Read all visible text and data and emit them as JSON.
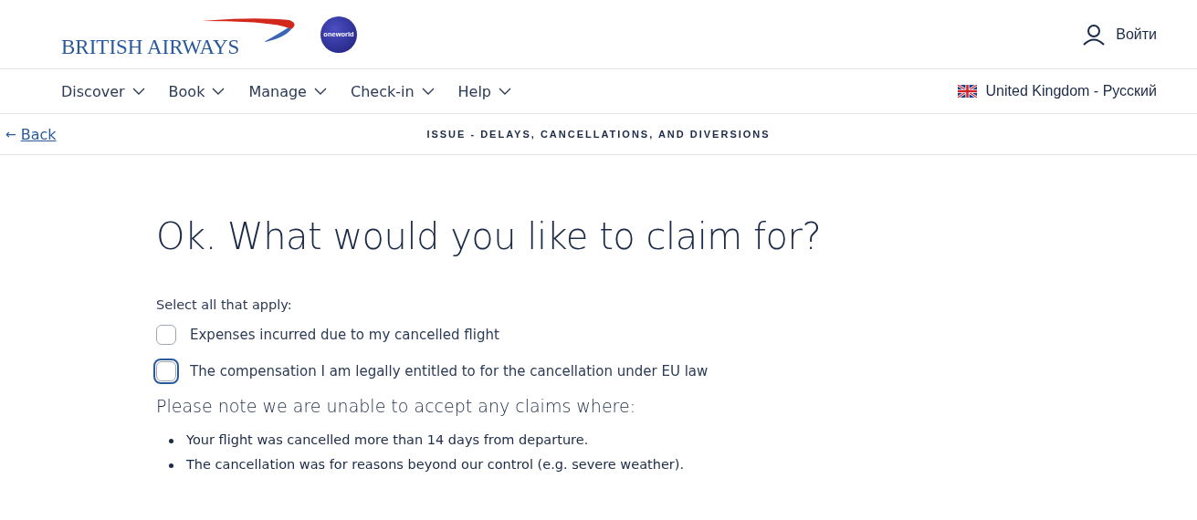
{
  "header": {
    "logo": {
      "text": "BRITISH AIRWAYS",
      "partner": "oneworld"
    },
    "login": "Войти"
  },
  "nav": {
    "items": [
      {
        "label": "Discover"
      },
      {
        "label": "Book"
      },
      {
        "label": "Manage"
      },
      {
        "label": "Check-in"
      },
      {
        "label": "Help"
      }
    ],
    "locale": "United Kingdom - Русский"
  },
  "subbar": {
    "back": "Back",
    "back_arrow": "←",
    "title": "ISSUE - DELAYS, CANCELLATIONS, AND DIVERSIONS"
  },
  "heading": "Ok. What would you like to claim for?",
  "instruction": "Select all that apply:",
  "options": [
    {
      "label": "Expenses incurred due to my cancelled flight",
      "checked": false,
      "focused": false
    },
    {
      "label": "The compensation I am legally entitled to for the cancellation under EU law",
      "checked": false,
      "focused": true
    }
  ],
  "note": {
    "title": "Please note we are unable to accept any claims where:",
    "items": [
      "Your flight was cancelled more than 14 days from departure.",
      "The cancellation was for reasons beyond our control (e.g. severe weather)."
    ]
  }
}
